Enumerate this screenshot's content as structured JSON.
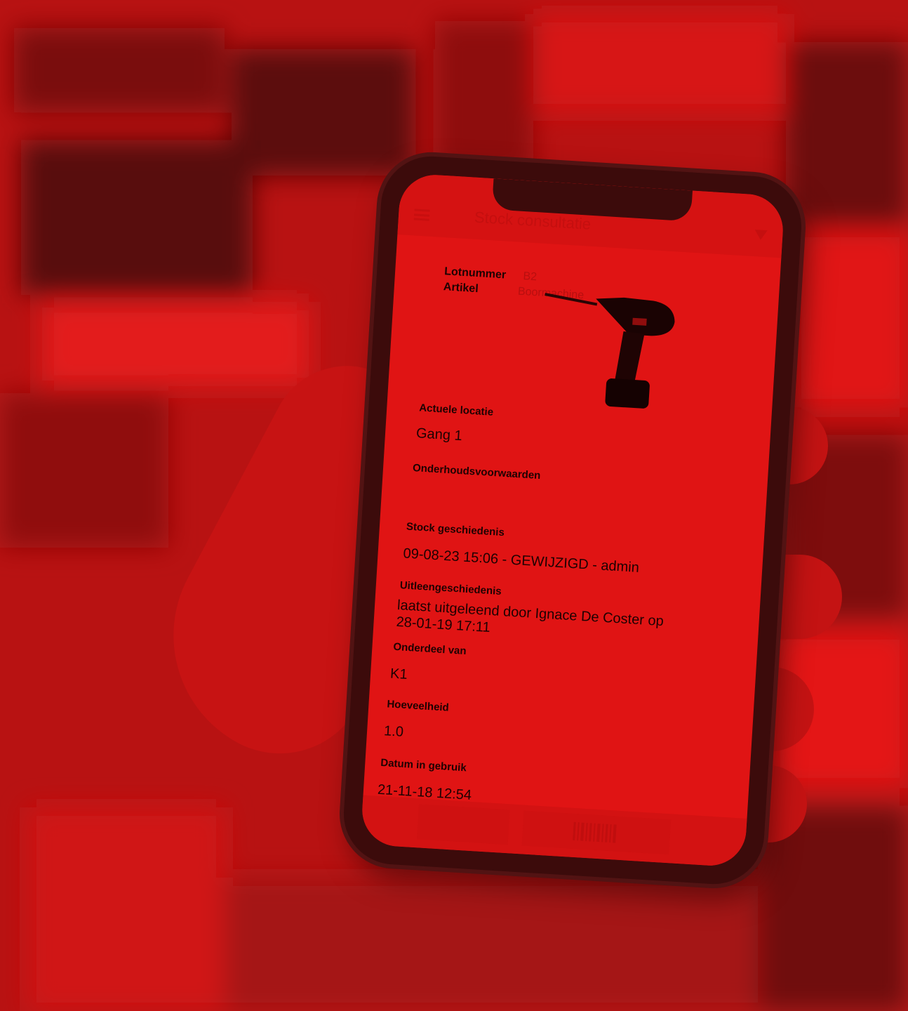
{
  "app": {
    "title": "Stock consultatie"
  },
  "header_fields": {
    "lot_label": "Lotnummer",
    "lot_value": "B2",
    "article_label": "Artikel",
    "article_value": "Boormachine"
  },
  "sections": [
    {
      "label": "Actuele locatie",
      "value": "Gang 1"
    },
    {
      "label": "Onderhoudsvoorwaarden",
      "value": ""
    },
    {
      "label": "Stock geschiedenis",
      "value": "09-08-23 15:06 - GEWIJZIGD - admin"
    },
    {
      "label": "Uitleengeschiedenis",
      "value": "laatst uitgeleend door Ignace De Coster op",
      "value2": "28-01-19 17:11"
    },
    {
      "label": "Onderdeel van",
      "value": "K1"
    },
    {
      "label": "Hoeveelheid",
      "value": "1.0"
    },
    {
      "label": "Datum in gebruik",
      "value": "21-11-18 12:54"
    }
  ],
  "colors": {
    "tint": "#e01414",
    "dark": "#1e0202",
    "phone": "#3c0b0b"
  },
  "icons": {
    "menu": "hamburger-icon",
    "filter": "filter-icon",
    "barcode": "barcode-icon"
  }
}
